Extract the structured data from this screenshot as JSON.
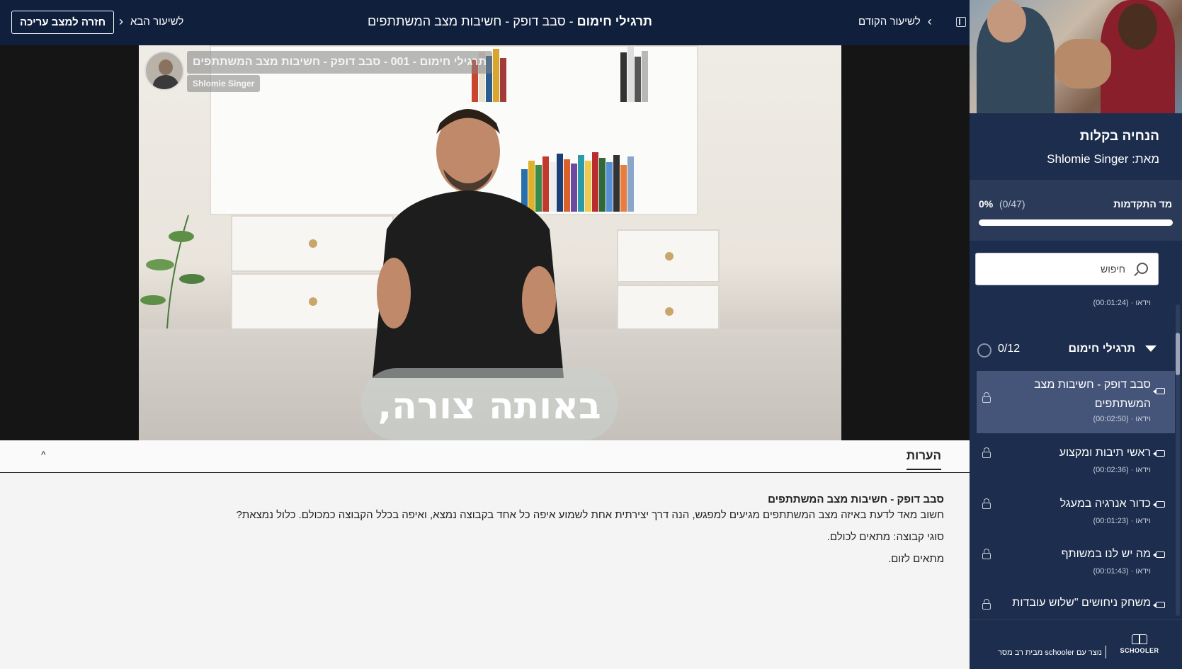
{
  "topbar": {
    "back_to_edit": "חזרה למצב עריכה",
    "next_lesson": "לשיעור הבא",
    "lesson_section": "תרגילי חימום",
    "lesson_title_rest": " - סבב דופק - חשיבות מצב המשתתפים",
    "prev_lesson": "לשיעור הקודם"
  },
  "video": {
    "overlay_title": "תרגילי חימום - 001 - סבב דופק - חשיבות מצב המשתתפים",
    "overlay_author": "Shlomie Singer",
    "caption": "באותה צורה,"
  },
  "notes": {
    "tab_label": "הערות",
    "toggle": "^",
    "heading": "סבב דופק - חשיבות מצב המשתתפים",
    "paragraph": "חשוב מאד לדעת באיזה מצב המשתתפים מגיעים למפגש, הנה דרך יצירתית אחת לשמוע איפה כל אחד בקבוצה נמצא, ואיפה בכלל הקבוצה כמכולם. כלול נמצאת?",
    "group_type": "סוגי קבוצה: מתאים לכולם.",
    "zoom": "מתאים לזום."
  },
  "sidebar": {
    "course_title": "הנחיה בקלות",
    "course_author": "מאת: Shlomie Singer",
    "progress_label": "מד התקדמות",
    "progress_count": "(0/47)",
    "progress_percent": "0%",
    "progress_value": 0,
    "search_label": "חיפוש",
    "partial_item_meta": {
      "type": "וידאו",
      "duration": "(00:01:24)"
    },
    "section": {
      "name": "תרגילי חימום",
      "count": "0/12"
    },
    "lessons": [
      {
        "title": "סבב דופק - חשיבות מצב המשתתפים",
        "type": "וידאו",
        "duration": "(00:02:50)"
      },
      {
        "title": "ראשי תיבות ומקצוע",
        "type": "וידאו",
        "duration": "(00:02:36)"
      },
      {
        "title": "כדור אנרגיה במעגל",
        "type": "וידאו",
        "duration": "(00:01:23)"
      },
      {
        "title": "מה יש לנו במשותף",
        "type": "וידאו",
        "duration": "(00:01:43)"
      },
      {
        "title": "משחק ניחושים \"שלוש עובדות",
        "type": "",
        "duration": ""
      }
    ],
    "footer_made": "נוצר עם schooler מבית רב מסר",
    "footer_logo": "SCHOOLER"
  },
  "colors": {
    "topbar_bg": "#0f1f3c",
    "sidebar_bg": "#1c2d4d",
    "active_lesson_bg": "#45557a"
  }
}
